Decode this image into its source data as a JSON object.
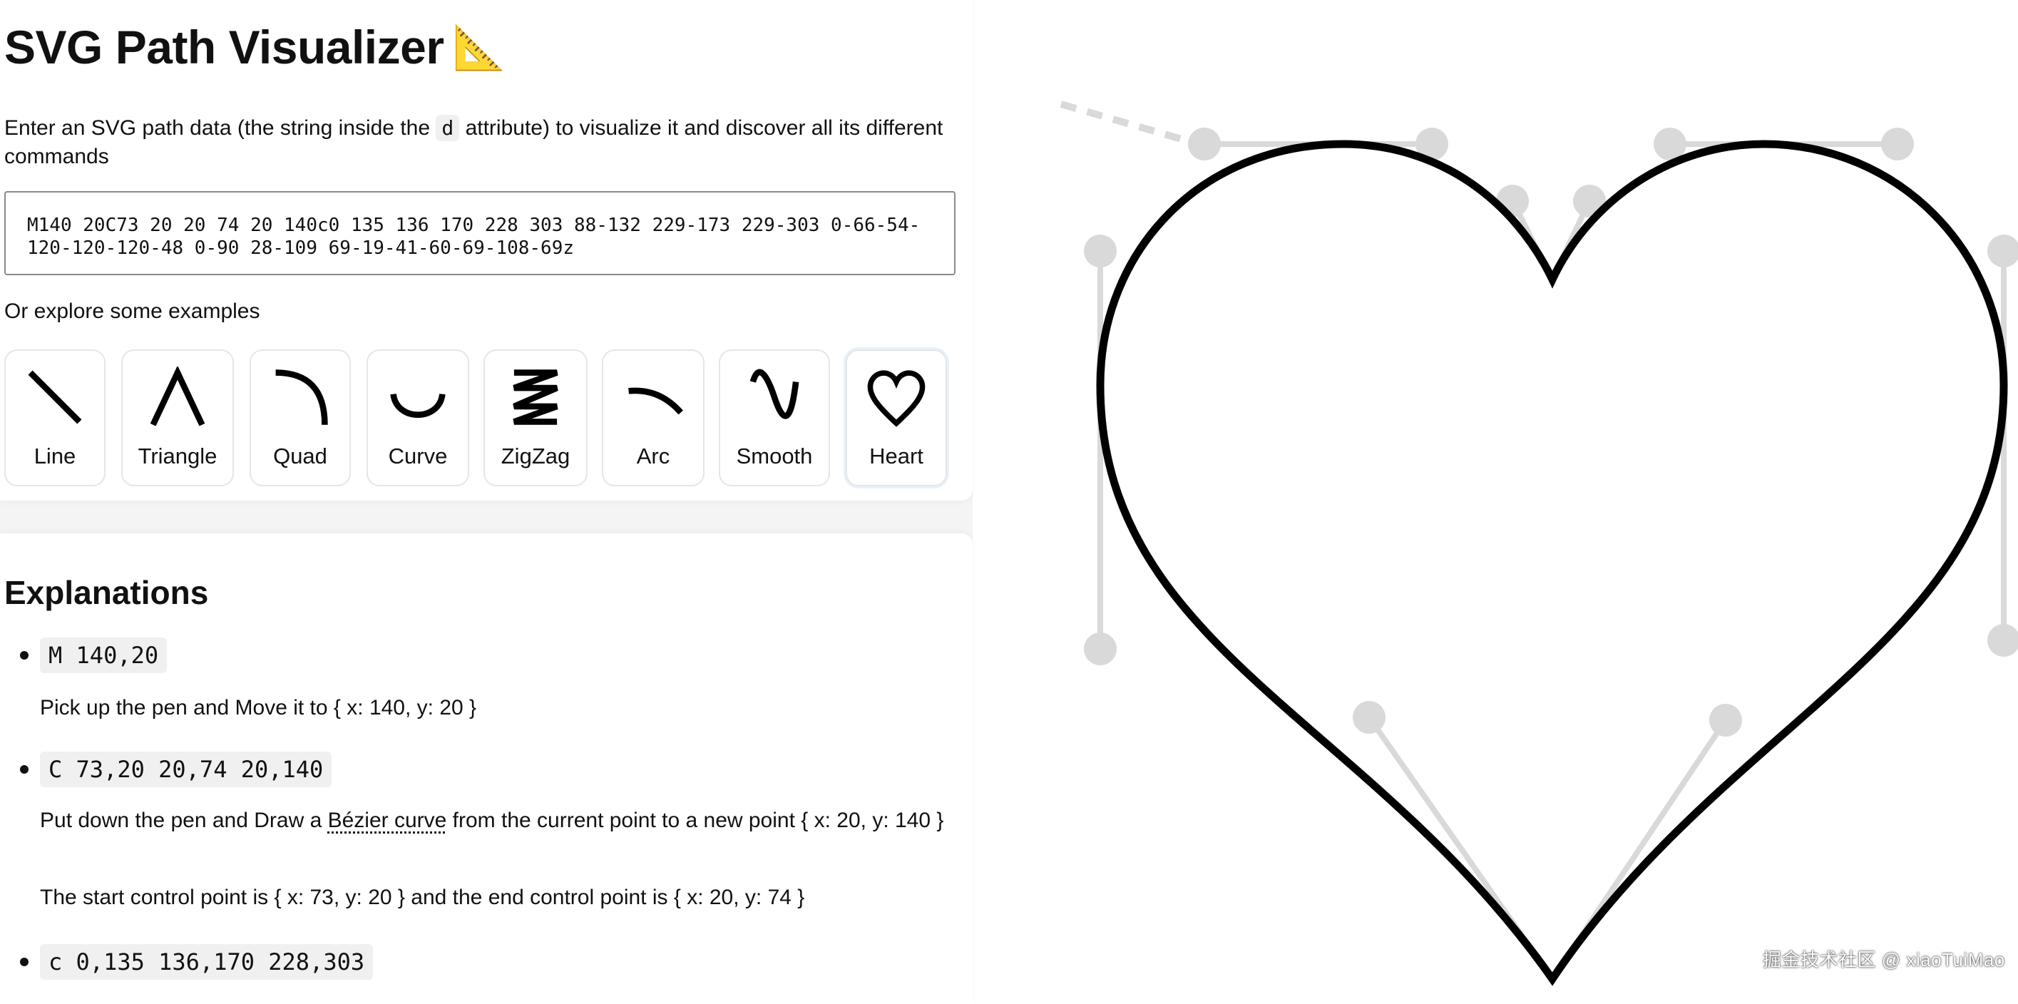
{
  "header": {
    "title": "SVG Path Visualizer",
    "title_emoji": "📐"
  },
  "intro": {
    "before": "Enter an SVG path data (the string inside the ",
    "code": "d",
    "after": " attribute) to visualize it and discover all its different commands"
  },
  "path_input": {
    "value": "M140 20C73 20 20 74 20 140c0 135 136 170 228 303 88-132 229-173 229-303 0-66-54-120-120-120-48 0-90 28-109 69-19-41-60-69-108-69z"
  },
  "examples": {
    "label": "Or explore some examples",
    "items": [
      {
        "label": "Line",
        "icon": "line-icon"
      },
      {
        "label": "Triangle",
        "icon": "triangle-icon"
      },
      {
        "label": "Quad",
        "icon": "quad-icon"
      },
      {
        "label": "Curve",
        "icon": "curve-icon"
      },
      {
        "label": "ZigZag",
        "icon": "zigzag-icon"
      },
      {
        "label": "Arc",
        "icon": "arc-icon"
      },
      {
        "label": "Smooth",
        "icon": "smooth-icon"
      },
      {
        "label": "Heart",
        "icon": "heart-icon"
      }
    ]
  },
  "explanations": {
    "title": "Explanations",
    "items": [
      {
        "command": "M 140,20",
        "desc": "Pick up the pen and Move it to { x: 140, y: 20 }"
      },
      {
        "command": "C 73,20 20,74 20,140",
        "desc_before": "Put down the pen and Draw a ",
        "desc_link": "Bézier curve",
        "desc_after": " from the current point to a new point { x: 20, y: 140 }",
        "desc2": "The start control point is { x: 73, y: 20 } and the end control point is { x: 20, y: 74 }"
      },
      {
        "command": "c 0,135 136,170 228,303"
      }
    ]
  },
  "watermark": "掘金技术社区 @ xiaoTuiMao",
  "colors": {
    "stroke": "#000000",
    "guide": "#d9d9d9",
    "panel_bg": "#f4f4f5"
  }
}
